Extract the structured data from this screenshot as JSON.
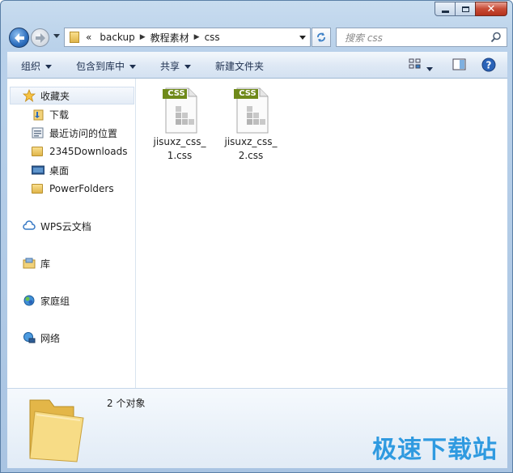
{
  "window": {
    "caption_buttons": {
      "minimize": "minimize",
      "maximize": "maximize",
      "close": "close"
    }
  },
  "address_bar": {
    "overflow": "«",
    "crumbs": [
      "backup",
      "教程素材",
      "css"
    ]
  },
  "search": {
    "placeholder": "搜索 css"
  },
  "toolbar": {
    "organize": "组织",
    "include_in_library": "包含到库中",
    "share": "共享",
    "new_folder": "新建文件夹"
  },
  "nav_pane": {
    "favorites": "收藏夹",
    "items": [
      "下载",
      "最近访问的位置",
      "2345Downloads",
      "桌面",
      "PowerFolders"
    ],
    "wps": "WPS云文档",
    "library": "库",
    "homegroup": "家庭组",
    "network": "网络"
  },
  "files": [
    {
      "badge": "CSS",
      "name": "jisuxz_css_1.css"
    },
    {
      "badge": "CSS",
      "name": "jisuxz_css_2.css"
    }
  ],
  "details": {
    "count_text": "2 个对象"
  },
  "watermark": "极速下载站",
  "colors": {
    "css_badge": "#6f8a1a",
    "accent": "#2f9ae0",
    "folder": "#e8c35a"
  },
  "icons": {
    "back": "back-arrow-icon",
    "forward": "forward-arrow-icon",
    "refresh": "refresh-icon",
    "search": "search-icon",
    "view": "view-options-icon",
    "preview": "preview-pane-icon",
    "help": "help-icon"
  }
}
